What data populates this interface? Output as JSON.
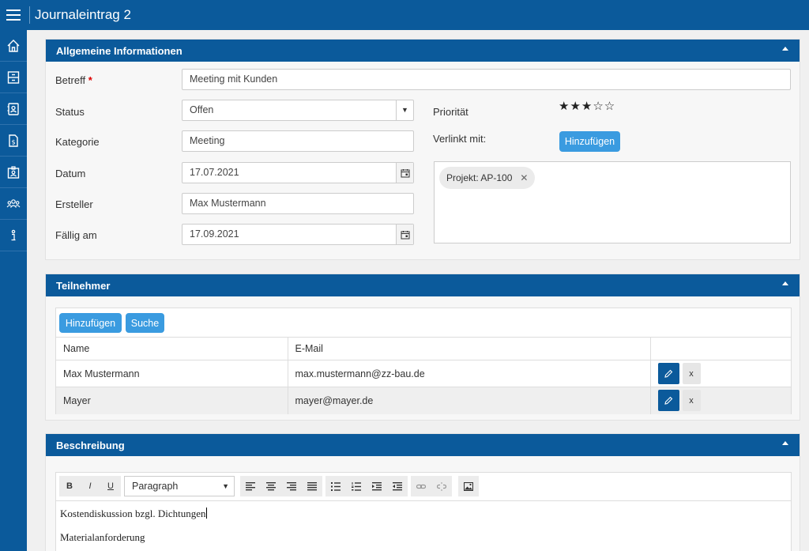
{
  "app": {
    "title": "Journaleintrag 2"
  },
  "sidebar": {
    "items": [
      {
        "icon": "home-icon"
      },
      {
        "icon": "archive-icon"
      },
      {
        "icon": "contact-book-icon"
      },
      {
        "icon": "invoice-icon"
      },
      {
        "icon": "id-card-icon"
      },
      {
        "icon": "users-group-icon"
      },
      {
        "icon": "info-icon"
      }
    ]
  },
  "general": {
    "header": "Allgemeine Informationen",
    "subject": {
      "label": "Betreff",
      "required_mark": "*",
      "value": "Meeting mit Kunden"
    },
    "status": {
      "label": "Status",
      "value": "Offen"
    },
    "category": {
      "label": "Kategorie",
      "value": "Meeting"
    },
    "date": {
      "label": "Datum",
      "value": "17.07.2021"
    },
    "creator": {
      "label": "Ersteller",
      "value": "Max Mustermann"
    },
    "due": {
      "label": "Fällig am",
      "value": "17.09.2021"
    },
    "priority": {
      "label": "Priorität",
      "rating": 3,
      "max": 5,
      "stars": "★★★☆☆"
    },
    "linked": {
      "label": "Verlinkt mit:",
      "add_label": "Hinzufügen",
      "chips": [
        "Projekt: AP-100"
      ],
      "remove_glyph": "✕"
    }
  },
  "participants": {
    "header": "Teilnehmer",
    "add_label": "Hinzufügen",
    "search_label": "Suche",
    "columns": [
      "Name",
      "E-Mail",
      ""
    ],
    "rows": [
      {
        "name": "Max Mustermann",
        "email": "max.mustermann@zz-bau.de"
      },
      {
        "name": "Mayer",
        "email": "mayer@mayer.de"
      }
    ],
    "remove_label": "x"
  },
  "description": {
    "header": "Beschreibung",
    "toolbar": {
      "bold": "B",
      "italic": "I",
      "underline": "U",
      "format": "Paragraph"
    },
    "paragraphs": [
      "Kostendiskussion bzgl. Dichtungen",
      "Materialanforderung"
    ]
  },
  "colors": {
    "primary": "#0b5a9b",
    "button": "#3a9be0",
    "required": "#dd0000"
  }
}
